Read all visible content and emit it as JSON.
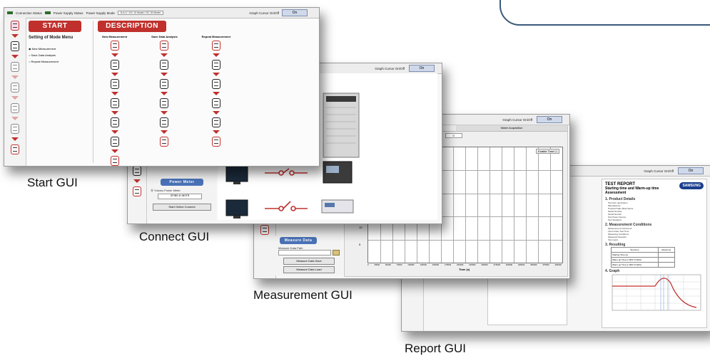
{
  "top_bar_decoration": "",
  "captions": {
    "start": "Start GUI",
    "connect": "Connect  GUI",
    "measurement": "Measurement GUI",
    "report": "Report GUI"
  },
  "start_gui": {
    "status": {
      "connection_label": "Connection Status",
      "power_supply_status_label": "Power Supply Status",
      "power_supply_mode_label": "Power Supply Mode",
      "mode_value": "N.A.C / DC 10 Model / DC 15 Model",
      "graph_cursor_label": "Graph Cursor On/Off",
      "graph_cursor_button": "On"
    },
    "start_button": "START",
    "description_button": "DESCRIPTION",
    "mode_menu_title": "Setting of Mode Menu",
    "modes": [
      "New Measurement",
      "Save Data Analysis",
      "Repeat Measurement"
    ],
    "columns": [
      "New Measurement",
      "Save Data Analysis",
      "Repeat Measurement"
    ]
  },
  "connect_gui": {
    "graph_cursor_label": "Graph Cursor On/Off",
    "graph_cursor_button": "On",
    "power_meter_button": "Power Meter",
    "visa_label": "Ⓜ Yokosu Power Meter",
    "visa_value": "GPIB0::8::INSTR",
    "connect_button": "Start Online Connect"
  },
  "measurement_gui": {
    "graph_cursor_label": "Graph Cursor On/Off",
    "graph_cursor_button": "On",
    "tab_water": "Water Acquisition",
    "recent_stable_label": "Recent Stable Percent (%)",
    "recent_stable_value": "0.050",
    "stabilization_label": "Stabilization Time (s)",
    "stabilization_value": "0",
    "enable_time": "Enable Time",
    "x_axis_label": "Time (s)",
    "x_ticks": [
      "0",
      "25000",
      "50000",
      "75000",
      "100000",
      "125000",
      "150000",
      "175000",
      "200000",
      "225000",
      "250000",
      "275000",
      "300000",
      "325000",
      "350000",
      "375000",
      "400000"
    ],
    "y_ticks": [
      "20",
      "15",
      "10",
      "5",
      "0"
    ],
    "measure_data_button": "Measure Data",
    "measure_path_label": "Measure Data Path",
    "measure_save_button": "Measure Data Save",
    "measure_load_button": "Measure Data Load"
  },
  "report_gui": {
    "graph_cursor_label": "Graph Cursor On/Off",
    "graph_cursor_button": "On",
    "title_line1": "TEST REPORT",
    "title_line2": "Starting time and Warm-up time Assessment",
    "brand": "SAMSUNG",
    "sections": [
      "1. Product Details",
      "2. Measurement Conditions",
      "3. Resulting",
      "4. Graph"
    ],
    "product_items": [
      "Test Item description",
      "Manufacturer",
      "Product/Trade Mark Name",
      "Model Number",
      "Serial Number",
      "Test Power Source",
      "Test Standard"
    ],
    "condition_items": [
      "Measurement Instrument",
      "Input Under Test Time",
      "Measuring Conditions",
      "Measured Scenario",
      "Test result"
    ],
    "result_headers": [
      "Test Item",
      "Result (s)"
    ],
    "result_rows": [
      "Starting Time (s)",
      "Warm-up Time to 90% P (W/C)",
      "Warm-up Time to 99% P (W/C)"
    ]
  },
  "chart_color": "#c0302c"
}
